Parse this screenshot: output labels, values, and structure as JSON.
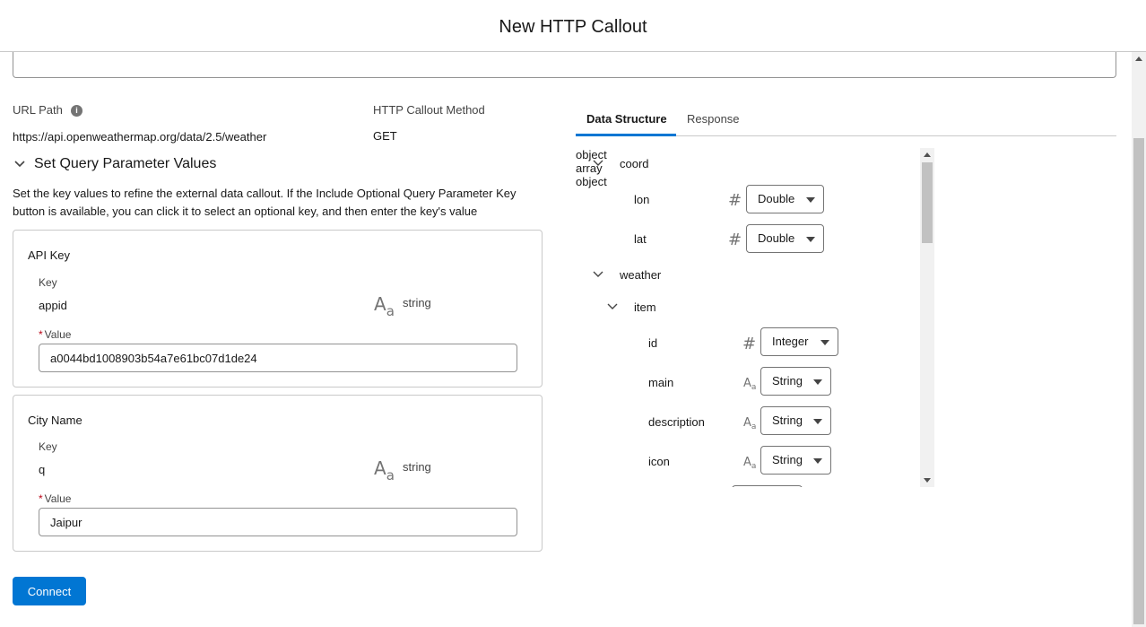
{
  "header": {
    "title": "New HTTP Callout"
  },
  "url_path": {
    "label": "URL Path",
    "value": "https://api.openweathermap.org/data/2.5/weather",
    "info_icon": "info-icon"
  },
  "method": {
    "label": "HTTP Callout Method",
    "value": "GET"
  },
  "query_section": {
    "title": "Set Query Parameter Values",
    "help": "Set the key values to refine the external data callout. If the Include Optional Query Parameter Key button is available, you can click it to select an optional key, and then enter the key's value"
  },
  "params": [
    {
      "title": "API Key",
      "key_label": "Key",
      "key": "appid",
      "type_icon": "Aa",
      "type": "string",
      "value_label": "Value",
      "required_mark": "*",
      "value": "a0044bd1008903b54a7e61bc07d1de24"
    },
    {
      "title": "City Name",
      "key_label": "Key",
      "key": "q",
      "type_icon": "Aa",
      "type": "string",
      "value_label": "Value",
      "required_mark": "*",
      "value": "Jaipur"
    }
  ],
  "connect_label": "Connect",
  "tabs": [
    {
      "label": "Data Structure",
      "active": true
    },
    {
      "label": "Response",
      "active": false
    }
  ],
  "tree": [
    {
      "name": "coord",
      "type": "object",
      "expandable": true
    },
    {
      "name": "lon",
      "type": "Double",
      "type_icon": "#"
    },
    {
      "name": "lat",
      "type": "Double",
      "type_icon": "#"
    },
    {
      "name": "weather",
      "type": "array",
      "expandable": true
    },
    {
      "name": "item",
      "type": "object",
      "expandable": true
    },
    {
      "name": "id",
      "type": "Integer",
      "type_icon": "#"
    },
    {
      "name": "main",
      "type": "String",
      "type_icon": "Aa"
    },
    {
      "name": "description",
      "type": "String",
      "type_icon": "Aa"
    },
    {
      "name": "icon",
      "type": "String",
      "type_icon": "Aa"
    }
  ],
  "colors": {
    "brand": "#0176d3",
    "border": "#c9c9c9",
    "muted": "#939393"
  }
}
